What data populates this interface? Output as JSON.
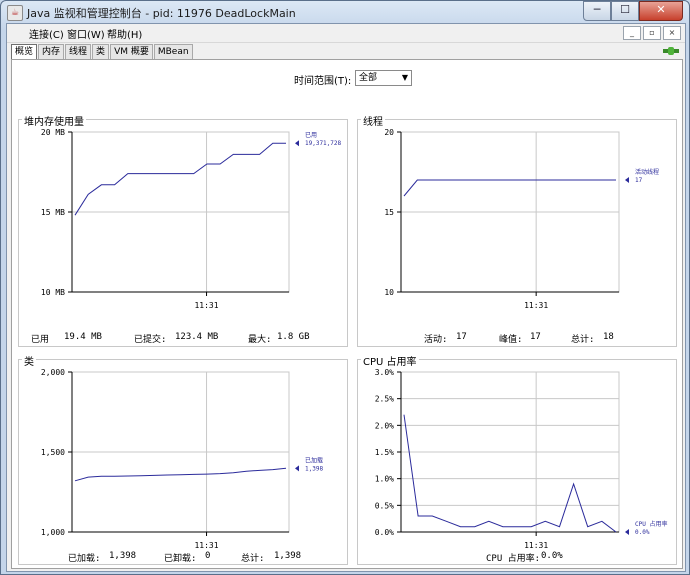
{
  "window": {
    "title": "Java 监视和管理控制台 - pid: 11976 DeadLockMain",
    "min_label": "─",
    "max_label": "☐",
    "close_label": "✕"
  },
  "menu": [
    "连接(C)",
    "窗口(W)",
    "帮助(H)"
  ],
  "mdi": [
    "_",
    "▫",
    "×"
  ],
  "tabs": [
    "概览",
    "内存",
    "线程",
    "类",
    "VM 概要",
    "MBean"
  ],
  "time_range": {
    "label": "时间范围(T):",
    "value": "全部"
  },
  "panels": {
    "heap": {
      "title": "堆内存使用量",
      "y_ticks": [
        "20 MB",
        "15 MB",
        "10 MB"
      ],
      "x_tick": "11:31",
      "legend": [
        "已用",
        "19,371,728"
      ],
      "stats": [
        "已用",
        "19.4 MB",
        "已提交:",
        "123.4 MB",
        "最大:",
        "1.8 GB"
      ]
    },
    "threads": {
      "title": "线程",
      "y_ticks": [
        "20",
        "15",
        "10"
      ],
      "x_tick": "11:31",
      "legend": [
        "活动线程",
        "17"
      ],
      "stats": [
        "活动:",
        "17",
        "峰值:",
        "17",
        "总计:",
        "18"
      ]
    },
    "classes": {
      "title": "类",
      "y_ticks": [
        "2,000",
        "1,500",
        "1,000"
      ],
      "x_tick": "11:31",
      "legend": [
        "已加载",
        "1,398"
      ],
      "stats": [
        "已加载:",
        "1,398",
        "已卸载:",
        "0",
        "总计:",
        "1,398"
      ]
    },
    "cpu": {
      "title": "CPU 占用率",
      "y_ticks": [
        "3.0%",
        "2.5%",
        "2.0%",
        "1.5%",
        "1.0%",
        "0.5%",
        "0.0%"
      ],
      "x_tick": "11:31",
      "legend": [
        "CPU 占用率",
        "0.0%"
      ],
      "stats": [
        "CPU 占用率:",
        "0.0%"
      ]
    }
  },
  "chart_data": [
    {
      "type": "line",
      "title": "堆内存使用量",
      "ylim": [
        10,
        20
      ],
      "unit": "MB",
      "series": [
        {
          "name": "已用",
          "values": [
            14.8,
            16.1,
            16.7,
            16.7,
            17.4,
            17.4,
            17.4,
            17.4,
            17.4,
            17.4,
            18.0,
            18.0,
            18.6,
            18.6,
            18.6,
            19.3,
            19.3
          ]
        }
      ]
    },
    {
      "type": "line",
      "title": "线程",
      "ylim": [
        10,
        20
      ],
      "series": [
        {
          "name": "活动线程",
          "values": [
            16,
            17,
            17,
            17,
            17,
            17,
            17,
            17,
            17,
            17,
            17,
            17,
            17,
            17,
            17,
            17,
            17
          ]
        }
      ]
    },
    {
      "type": "line",
      "title": "类",
      "ylim": [
        1000,
        2000
      ],
      "series": [
        {
          "name": "已加载",
          "values": [
            1320,
            1343,
            1348,
            1349,
            1350,
            1352,
            1354,
            1356,
            1358,
            1360,
            1362,
            1365,
            1370,
            1380,
            1385,
            1390,
            1398
          ]
        }
      ]
    },
    {
      "type": "line",
      "title": "CPU 占用率",
      "ylim": [
        0,
        3.0
      ],
      "unit": "%",
      "series": [
        {
          "name": "CPU 占用率",
          "values": [
            2.2,
            0.3,
            0.3,
            0.2,
            0.1,
            0.1,
            0.2,
            0.1,
            0.1,
            0.1,
            0.2,
            0.1,
            0.9,
            0.1,
            0.2,
            0.0
          ]
        }
      ]
    }
  ],
  "colors": {
    "series": "#2b2b9b",
    "grid": "#c8c8c8",
    "axis": "#000000"
  },
  "icons": {
    "app": "java-icon",
    "connection": "connection-status-icon"
  }
}
